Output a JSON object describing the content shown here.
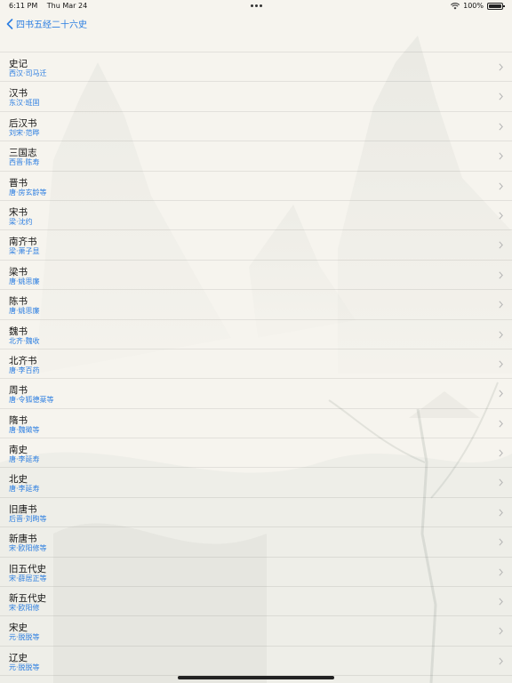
{
  "status_bar": {
    "time": "6:11 PM",
    "date": "Thu Mar 24",
    "battery": "100%"
  },
  "nav": {
    "back_label": "四书五经二十六史"
  },
  "list": [
    {
      "title": "史记",
      "subtitle": "西汉·司马迁"
    },
    {
      "title": "汉书",
      "subtitle": "东汉·班固"
    },
    {
      "title": "后汉书",
      "subtitle": "刘宋·范晔"
    },
    {
      "title": "三国志",
      "subtitle": "西晋·陈寿"
    },
    {
      "title": "晋书",
      "subtitle": "唐·房玄龄等"
    },
    {
      "title": "宋书",
      "subtitle": "梁·沈约"
    },
    {
      "title": "南齐书",
      "subtitle": "梁·萧子显"
    },
    {
      "title": "梁书",
      "subtitle": "唐·姚思廉"
    },
    {
      "title": "陈书",
      "subtitle": "唐·姚思廉"
    },
    {
      "title": "魏书",
      "subtitle": "北齐·魏收"
    },
    {
      "title": "北齐书",
      "subtitle": "唐·李百药"
    },
    {
      "title": "周书",
      "subtitle": "唐·令狐德棻等"
    },
    {
      "title": "隋书",
      "subtitle": "唐·魏徵等"
    },
    {
      "title": "南史",
      "subtitle": "唐·李延寿"
    },
    {
      "title": "北史",
      "subtitle": "唐·李延寿"
    },
    {
      "title": "旧唐书",
      "subtitle": "后晋·刘昫等"
    },
    {
      "title": "新唐书",
      "subtitle": "宋·欧阳修等"
    },
    {
      "title": "旧五代史",
      "subtitle": "宋·薛居正等"
    },
    {
      "title": "新五代史",
      "subtitle": "宋·欧阳修"
    },
    {
      "title": "宋史",
      "subtitle": "元·脱脱等"
    },
    {
      "title": "辽史",
      "subtitle": "元·脱脱等"
    }
  ],
  "colors": {
    "accent": "#2a7de1",
    "background": "#f6f4ee"
  },
  "icons": {
    "back": "chevron-left-icon",
    "row": "chevron-right-icon",
    "wifi": "wifi-icon",
    "battery": "battery-icon"
  }
}
